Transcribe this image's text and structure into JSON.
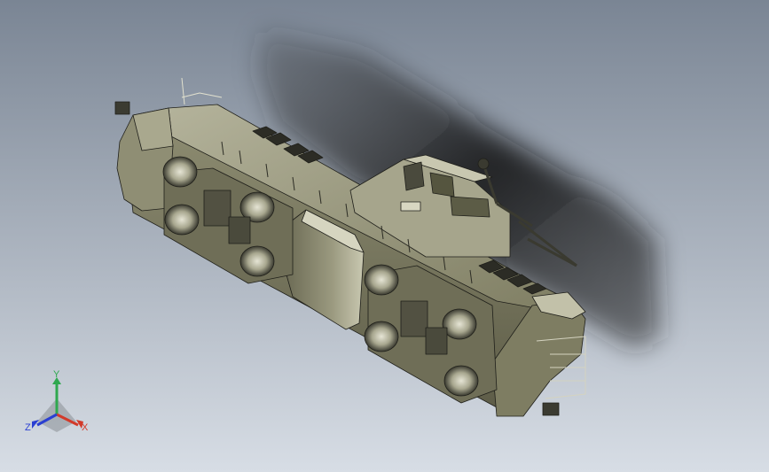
{
  "viewport": {
    "background_top": "#7a8594",
    "background_bottom": "#d7dde5",
    "model_body_color": "#8c8b70",
    "model_dark_color": "#3d3d33",
    "model_light_color": "#b9b8a0",
    "model_outline_color": "#1f1f1a",
    "shadow_color": "#1e1e1e"
  },
  "axis_triad": {
    "y_label": "Y",
    "x_label": "X",
    "z_label": "Z",
    "y_color": "#2fa84f",
    "x_color": "#d23a2a",
    "z_color": "#2a3fd2"
  }
}
